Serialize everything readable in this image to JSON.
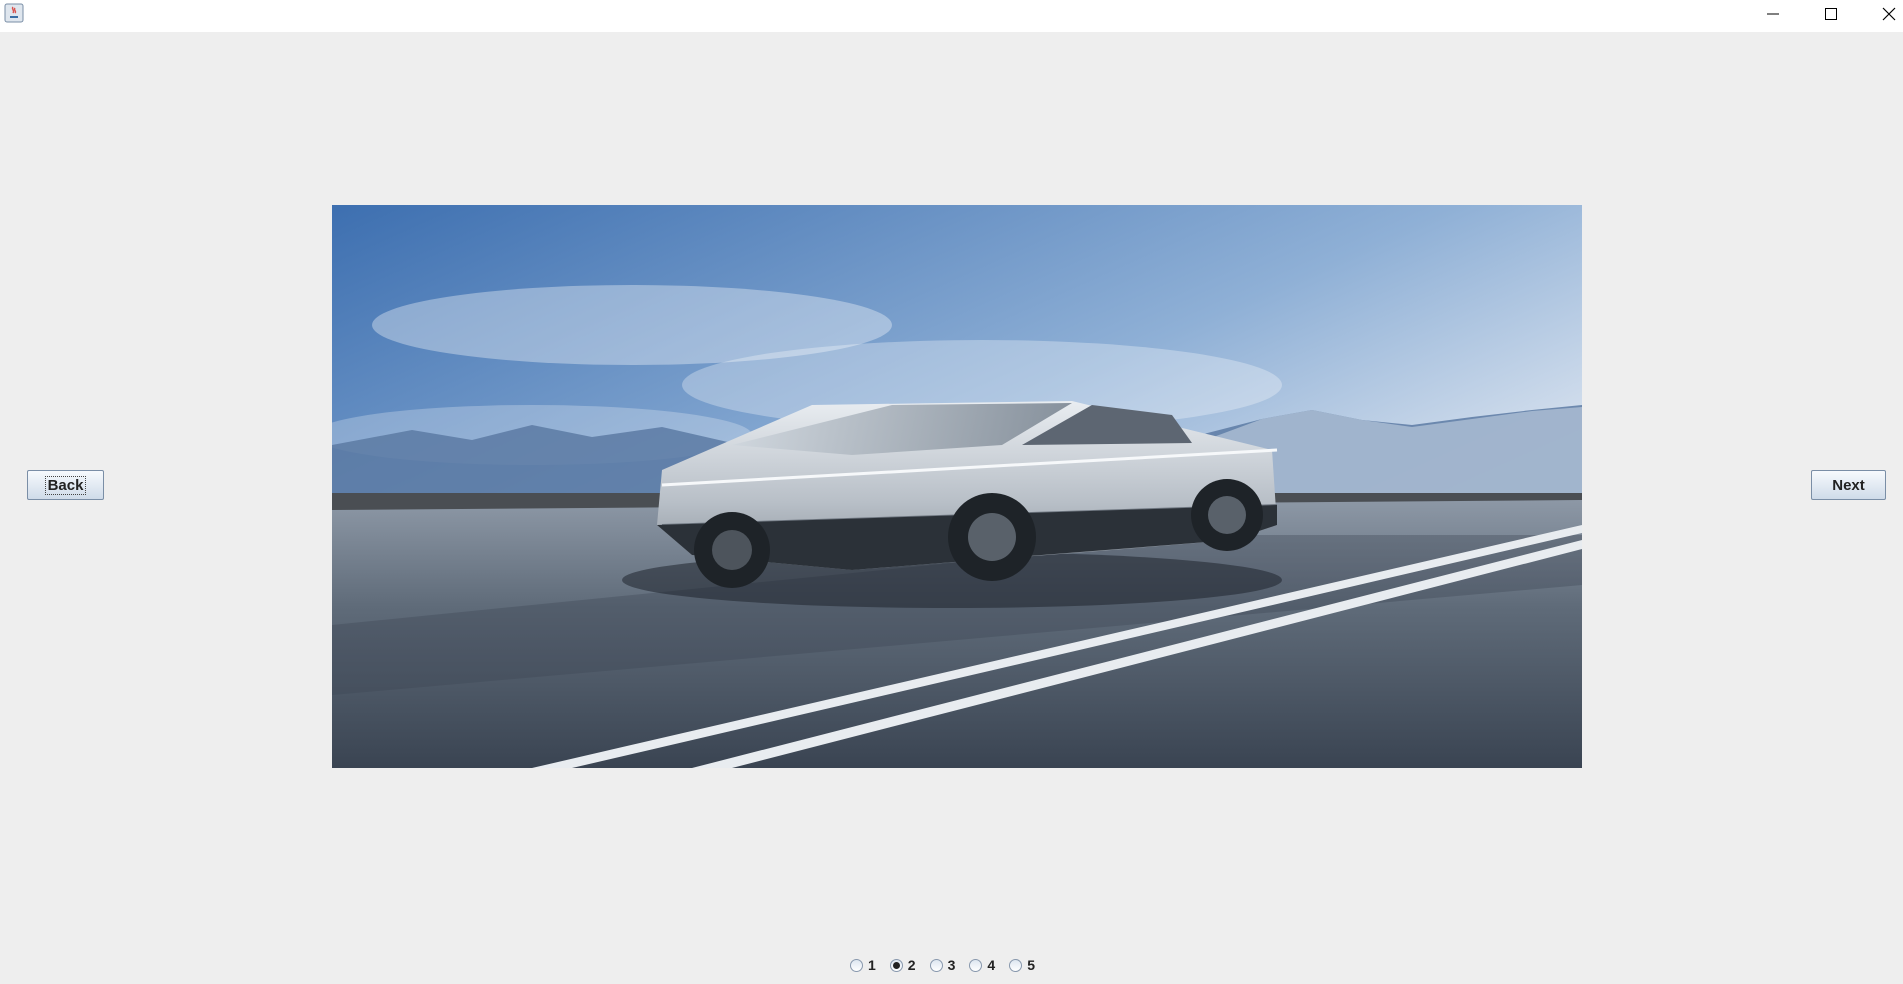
{
  "window": {
    "title": "",
    "controls": [
      "minimize",
      "maximize",
      "close"
    ]
  },
  "photo": {
    "alt": "Silver angular electric pickup truck on a desert road with mountains and a blue sky"
  },
  "navigation": {
    "back_label": "Back",
    "next_label": "Next"
  },
  "slides": {
    "options": [
      "1",
      "2",
      "3",
      "4",
      "5"
    ],
    "selected": "2"
  }
}
